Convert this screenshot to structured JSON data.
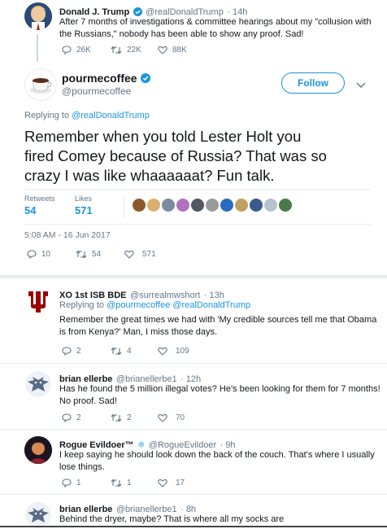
{
  "tweet0": {
    "name": "Donald J. Trump",
    "handle": "@realDonaldTrump",
    "time": "· 14h",
    "text_line1": "After 7 months of investigations & committee hearings about my \"collusion with",
    "text_line2": "the Russians,\"  nobody has been able to show any proof. Sad!",
    "replies": "26K",
    "retweets": "22K",
    "likes": "88K"
  },
  "main_tweet": {
    "name": "pourmecoffee",
    "handle": "@pourmecoffee",
    "follow_label": "Follow",
    "reply_prefix": "Replying to ",
    "reply_to": "@realDonaldTrump",
    "text_line1": "Remember when you told Lester Holt you",
    "text_line2": "fired Comey because of Russia? That was so",
    "text_line3": "crazy I was like whaaaaaat? Fun talk.",
    "retweets_label": "Retweets",
    "retweets_value": "54",
    "likes_label": "Likes",
    "likes_value": "571",
    "timestamp": "5:08 AM - 16 Jun 2017",
    "replies": "10",
    "retweets": "54",
    "likes": "571"
  },
  "replies": [
    {
      "name": "XO 1st ISB BDE",
      "handle": "@surrealmwshort",
      "time": "· 13h",
      "reply_prefix": "Replying to ",
      "reply_to": "@pourmecoffee @realDonaldTrump",
      "text_line1": "Remember the great times we had with 'My credible sources tell me that Obama",
      "text_line2": "is from Kenya?'  Man, I miss those days.",
      "replies": "2",
      "retweets": "4",
      "likes": "109"
    },
    {
      "name": "brian ellerbe",
      "handle": "@brianellerbe1",
      "time": "· 12h",
      "text_line1": "Has he found the 5 million illegal votes? He's been looking for them for 7 months!",
      "text_line2": "No proof.  Sad!",
      "replies": "2",
      "retweets": "2",
      "likes": "70"
    },
    {
      "name": "Rogue Evildoer™",
      "handle": "@RogueEvildoer",
      "time": "· 9h",
      "text_line1": "I keep saying he should look down the back of the couch. That's where I usually",
      "text_line2": "lose things.",
      "replies": "1",
      "retweets": "1",
      "likes": "17"
    },
    {
      "name": "brian ellerbe",
      "handle": "@brianellerbe1",
      "time": "· 8h",
      "text_line1": "Behind the dryer, maybe? That is where all my socks are"
    }
  ],
  "colors": {
    "accent": "#1b95e0",
    "text": "#14171a",
    "muted": "#657786",
    "divider": "#e6ecf0",
    "iu_red": "#990000"
  },
  "icons": [
    "reply-icon",
    "retweet-icon",
    "like-icon",
    "verified-badge-icon",
    "chevron-down-icon",
    "snowflake-icon"
  ]
}
